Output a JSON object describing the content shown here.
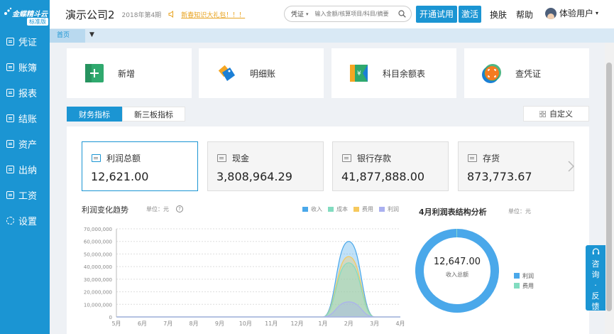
{
  "brand": {
    "name": "金蝶精斗云",
    "edition": "标准版"
  },
  "sidebar": {
    "items": [
      {
        "label": "凭证",
        "icon": "voucher-icon"
      },
      {
        "label": "账簿",
        "icon": "ledger-icon"
      },
      {
        "label": "报表",
        "icon": "report-icon"
      },
      {
        "label": "结账",
        "icon": "checkout-icon"
      },
      {
        "label": "资产",
        "icon": "asset-icon"
      },
      {
        "label": "出纳",
        "icon": "cashier-icon"
      },
      {
        "label": "工资",
        "icon": "salary-icon"
      },
      {
        "label": "设置",
        "icon": "gear-icon"
      }
    ]
  },
  "header": {
    "company": "演示公司2",
    "period": "2018年第4期",
    "notice": "新春知识大礼包！！！",
    "search": {
      "type": "凭证",
      "placeholder": "输入金额/核算项目/科目/摘要"
    },
    "trial_button": "开通试用",
    "activate_button": "激活",
    "skin_link": "换肤",
    "help_link": "帮助",
    "user": "体验用户"
  },
  "tabs": {
    "home": "首页"
  },
  "quick_actions": [
    {
      "label": "新增",
      "icon": "add-icon"
    },
    {
      "label": "明细账",
      "icon": "tags-icon"
    },
    {
      "label": "科目余额表",
      "icon": "balance-icon"
    },
    {
      "label": "查凭证",
      "icon": "scan-voucher-icon"
    }
  ],
  "subtabs": [
    {
      "label": "财务指标",
      "active": true
    },
    {
      "label": "新三板指标",
      "active": false
    }
  ],
  "customize_label": "自定义",
  "metrics": [
    {
      "label": "利润总额",
      "value": "12,621.00"
    },
    {
      "label": "现金",
      "value": "3,808,964.29"
    },
    {
      "label": "银行存款",
      "value": "41,877,888.00"
    },
    {
      "label": "存货",
      "value": "873,773.67"
    }
  ],
  "trend": {
    "title": "利润变化趋势",
    "unit": "单位：元"
  },
  "colors": {
    "primary": "#1b95d3",
    "income": "#4aa8ea",
    "cost": "#82dcc0",
    "expense": "#f6c95d",
    "profit": "#aab0f0"
  },
  "chart_data": {
    "type": "area",
    "categories": [
      "5月",
      "6月",
      "7月",
      "8月",
      "9月",
      "10月",
      "11月",
      "12月",
      "1月",
      "2月",
      "3月",
      "4月"
    ],
    "ylim": [
      0,
      70000000
    ],
    "yticks": [
      "70,000,000",
      "60,000,000",
      "50,000,000",
      "40,000,000",
      "30,000,000",
      "20,000,000",
      "10,000,000",
      "0"
    ],
    "series": [
      {
        "name": "收入",
        "values": [
          0,
          0,
          0,
          0,
          0,
          0,
          0,
          0,
          0,
          60000000,
          0,
          0
        ]
      },
      {
        "name": "成本",
        "values": [
          0,
          0,
          0,
          0,
          0,
          0,
          0,
          0,
          0,
          43000000,
          0,
          0
        ]
      },
      {
        "name": "费用",
        "values": [
          0,
          0,
          0,
          0,
          0,
          0,
          0,
          0,
          0,
          48000000,
          0,
          0
        ]
      },
      {
        "name": "利润",
        "values": [
          0,
          0,
          0,
          0,
          0,
          0,
          0,
          0,
          0,
          12000000,
          0,
          0
        ]
      }
    ],
    "grid": true,
    "legend": "top-right"
  },
  "structure": {
    "title": "4月利润表结构分析",
    "unit": "单位：元",
    "center_value": "12,647.00",
    "center_label": "收入总额",
    "legend": [
      {
        "name": "利润"
      },
      {
        "name": "费用"
      }
    ],
    "slices": [
      {
        "name": "利润",
        "value": 12621
      },
      {
        "name": "费用",
        "value": 26
      }
    ]
  },
  "consult": [
    "咨",
    "询",
    "·",
    "反",
    "馈"
  ]
}
